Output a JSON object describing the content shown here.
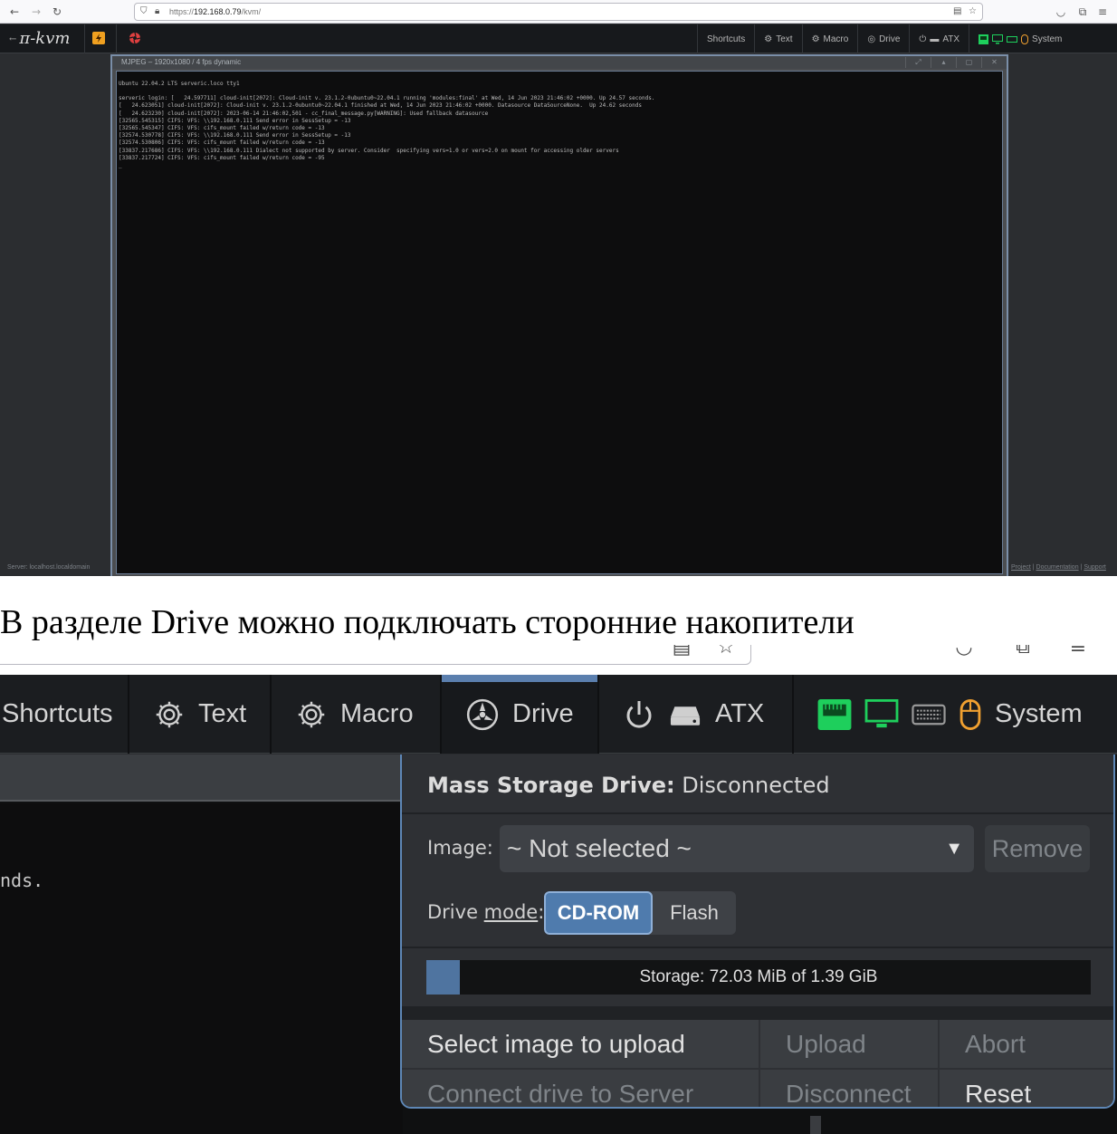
{
  "browser": {
    "url_prefix": "https://",
    "url_host": "192.168.0.79",
    "url_path": "/kvm/"
  },
  "kvm": {
    "logo": "π-kvm",
    "menu": {
      "shortcuts": "Shortcuts",
      "text": "Text",
      "macro": "Macro",
      "drive": "Drive",
      "atx": "ATX",
      "system": "System"
    },
    "video": {
      "title": "MJPEG – 1920x1080 / 4 fps dynamic",
      "terminal_lines": [
        "Ubuntu 22.04.2 LTS serveric.loco tty1",
        "",
        "serveric login: [   24.597711] cloud-init[2072]: Cloud-init v. 23.1.2-0ubuntu0~22.04.1 running 'modules:final' at Wed, 14 Jun 2023 21:46:02 +0000. Up 24.57 seconds.",
        "[   24.623051] cloud-init[2072]: Cloud-init v. 23.1.2-0ubuntu0~22.04.1 finished at Wed, 14 Jun 2023 21:46:02 +0000. Datasource DataSourceNone.  Up 24.62 seconds",
        "[   24.623230] cloud-init[2072]: 2023-06-14 21:46:02,501 - cc_final_message.py[WARNING]: Used fallback datasource",
        "[32565.545315] CIFS: VFS: \\\\192.168.0.111 Send error in SessSetup = -13",
        "[32565.545347] CIFS: VFS: cifs_mount failed w/return code = -13",
        "[32574.530778] CIFS: VFS: \\\\192.168.0.111 Send error in SessSetup = -13",
        "[32574.530806] CIFS: VFS: cifs_mount failed w/return code = -13",
        "[33837.217686] CIFS: VFS: \\\\192.168.0.111 Dialect not supported by server. Consider  specifying vers=1.0 or vers=2.0 on mount for accessing older servers",
        "[33837.217724] CIFS: VFS: cifs_mount failed w/return code = -95",
        "_"
      ]
    },
    "footer_left": "Server: localhost.localdomain",
    "footer_right": {
      "project": "Project",
      "documentation": "Documentation",
      "support": "Support"
    }
  },
  "caption": "В разделе Drive можно подключать сторонние накопители",
  "drive_panel": {
    "title_bold": "Mass Storage Drive:",
    "title_status": "Disconnected",
    "image_label": "Image:",
    "image_selected": "~ Not selected ~",
    "remove_label": "Remove",
    "mode_label_prefix": "Drive ",
    "mode_label_underlined": "mode",
    "mode_label_suffix": ":",
    "mode_options": [
      "CD-ROM",
      "Flash"
    ],
    "mode_selected": "CD-ROM",
    "storage_text": "Storage: 72.03 MiB of 1.39 GiB",
    "storage_used_fraction": 0.05,
    "buttons": {
      "select_upload": "Select image to upload",
      "upload": "Upload",
      "abort": "Abort",
      "connect": "Connect drive to Server",
      "disconnect": "Disconnect",
      "reset": "Reset"
    }
  },
  "terminal_fragment": "nds.",
  "colors": {
    "accent": "#5b7fae",
    "lan_green": "#1ecf5c",
    "mouse_orange": "#f0a030"
  }
}
